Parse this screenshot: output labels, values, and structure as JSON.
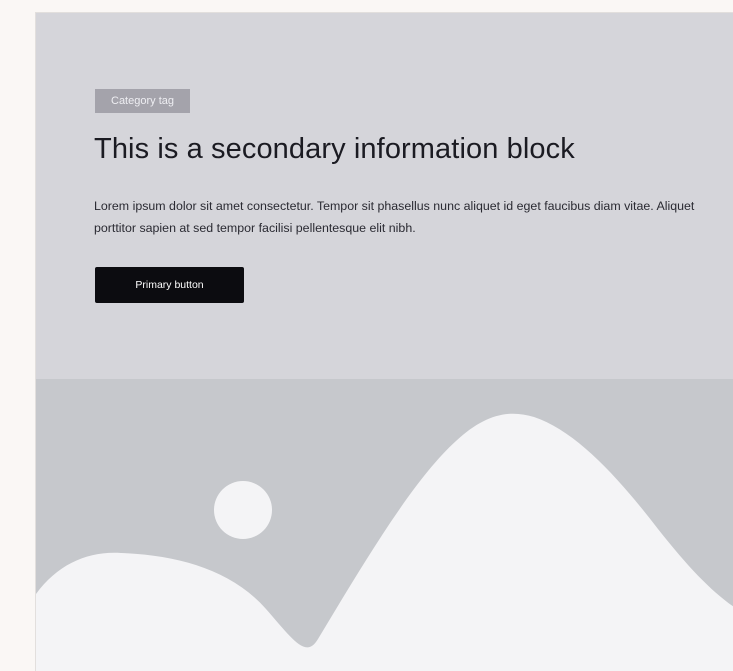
{
  "block": {
    "category_tag": "Category tag",
    "title": "This is a secondary information block",
    "description": "Lorem ipsum dolor sit amet consectetur. Tempor sit phasellus nunc aliquet id eget faucibus diam vitae. Aliquet porttitor sapien at sed tempor facilisi pellentesque elit nibh.",
    "primary_button_label": "Primary button"
  },
  "media": {
    "icon": "image-placeholder-icon"
  },
  "colors": {
    "page_background": "#faf7f5",
    "card_background": "#d5d5da",
    "tag_background": "#a4a3ab",
    "button_background": "#0c0c10",
    "media_background": "#c6c8cc",
    "media_shapes": "#f4f4f6"
  }
}
